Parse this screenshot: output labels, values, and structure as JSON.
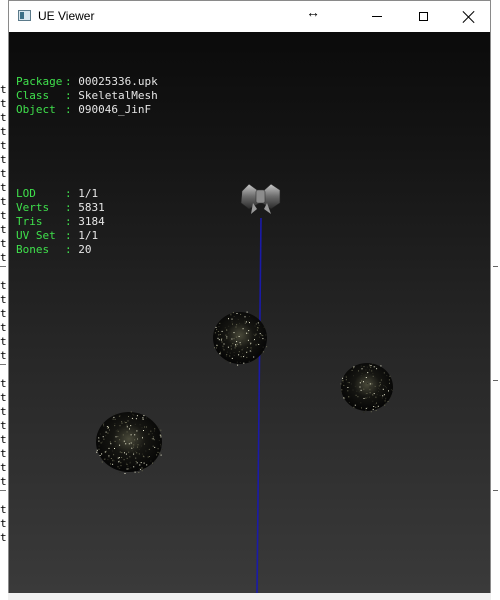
{
  "window": {
    "title": "UE Viewer",
    "resize_glyph": "↔",
    "icons": [
      "app-icon",
      "resize-icon",
      "minimize-icon",
      "maximize-icon",
      "close-icon"
    ]
  },
  "background_app": {
    "row_glyph": "t"
  },
  "info": {
    "object_info": [
      {
        "label": "Package",
        "value": "00025336.upk"
      },
      {
        "label": "Class",
        "value": "SkeletalMesh"
      },
      {
        "label": "Object",
        "value": "090046_JinF"
      }
    ],
    "mesh_stats": [
      {
        "label": "LOD",
        "value": "1/1"
      },
      {
        "label": "Verts",
        "value": "5831"
      },
      {
        "label": "Tris",
        "value": "3184"
      },
      {
        "label": "UV Set",
        "value": "1/1"
      },
      {
        "label": "Bones",
        "value": "20"
      }
    ],
    "separator": ":"
  },
  "colors": {
    "label_green": "#3fe04c",
    "value_white": "#e6e6e6",
    "axis_blue": "#1a1aa8"
  }
}
